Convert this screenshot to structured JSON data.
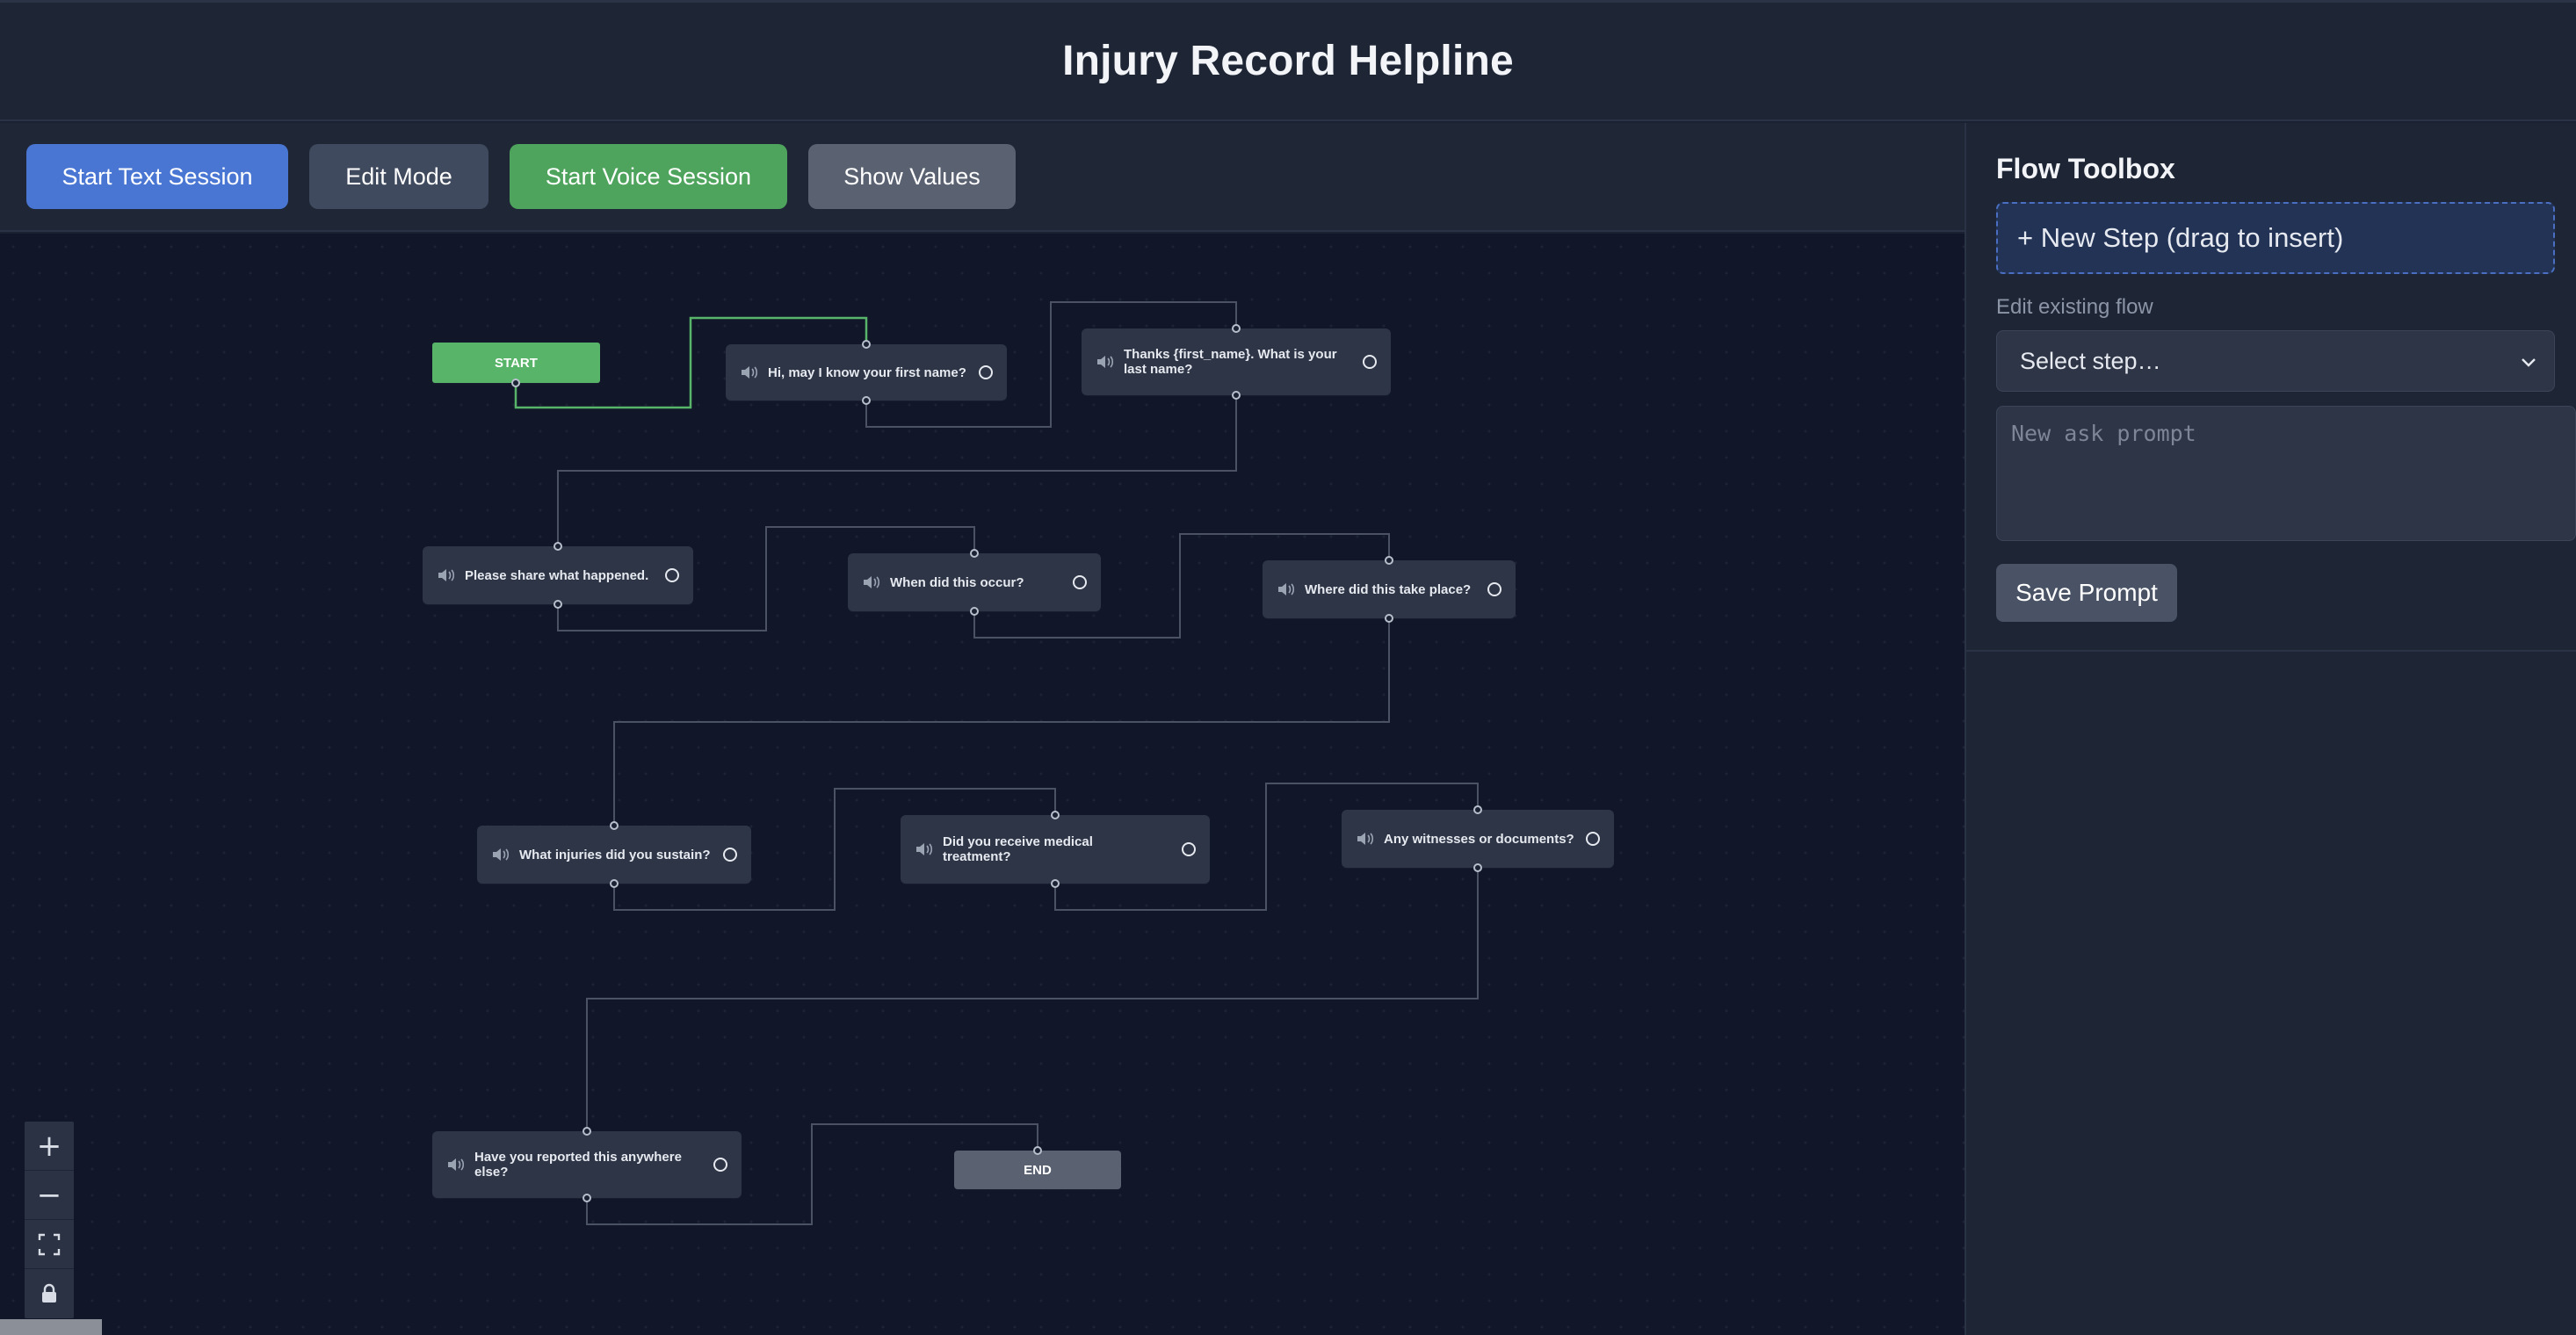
{
  "app": {
    "title": "Injury Record Helpline"
  },
  "toolbar": {
    "start_text": "Start Text Session",
    "edit_mode": "Edit Mode",
    "start_voice": "Start Voice Session",
    "show_values": "Show Values"
  },
  "flow": {
    "start_label": "START",
    "end_label": "END",
    "steps": [
      "Hi, may I know your first name?",
      "Thanks {first_name}. What is your last name?",
      "Please share what happened.",
      "When did this occur?",
      "Where did this take place?",
      "What injuries did you sustain?",
      "Did you receive medical treatment?",
      "Any witnesses or documents?",
      "Have you reported this anywhere else?"
    ]
  },
  "zoom_controls": {
    "zoom_in": "+",
    "zoom_out": "−",
    "fit_view": "⛶",
    "lock": "🔒"
  },
  "toolbox": {
    "title": "Flow Toolbox",
    "new_step": "+ New Step (drag to insert)",
    "edit_label": "Edit existing flow",
    "select_value": "Select step…",
    "prompt_placeholder": "New ask prompt",
    "save": "Save Prompt"
  },
  "colors": {
    "accent_blue": "#4a76d3",
    "accent_green": "#4ea45c",
    "start_node": "#58b468",
    "end_node": "#5a6272",
    "canvas_bg": "#111728",
    "edge": "#4a5263",
    "active_edge": "#58b468"
  },
  "icons": {
    "step_icon": "speaker-icon",
    "step_status": "circle-icon",
    "select_chevron": "chevron-down-icon"
  }
}
